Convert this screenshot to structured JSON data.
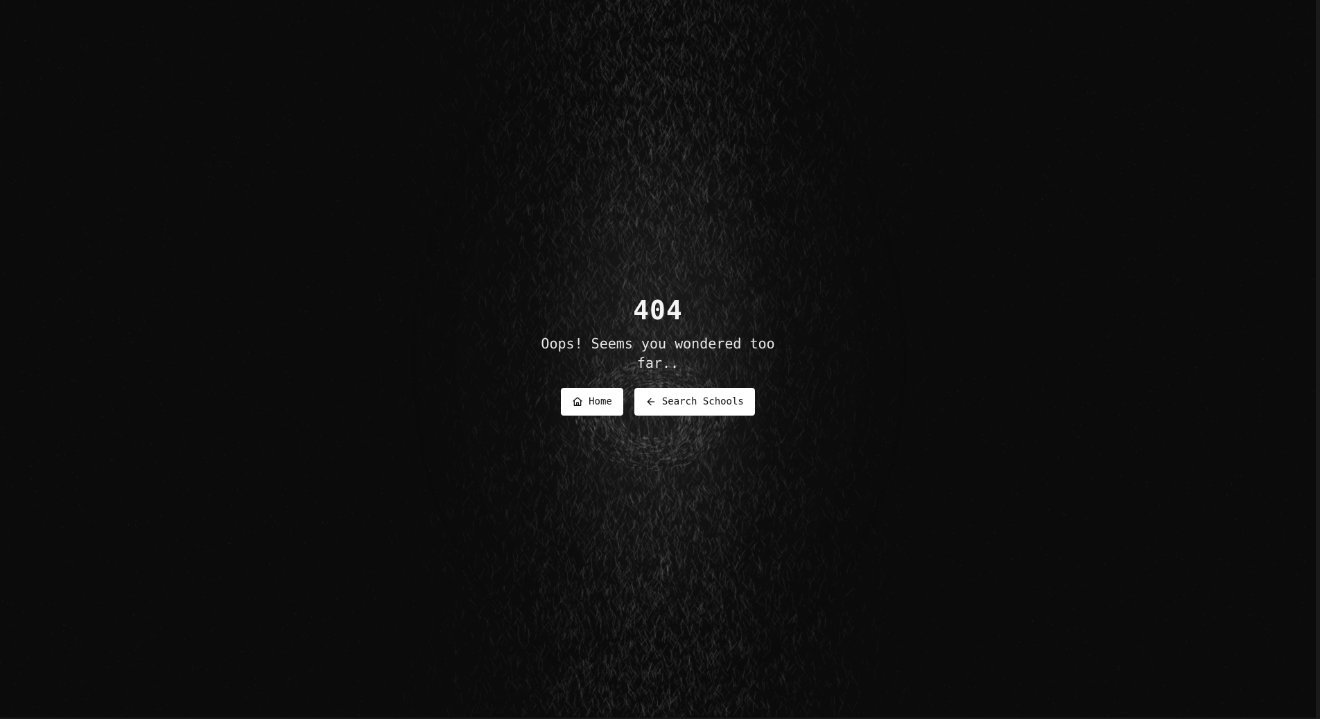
{
  "error": {
    "code": "404",
    "message": "Oops! Seems you wondered too far.."
  },
  "actions": {
    "home_label": "Home",
    "home_icon": "home-icon",
    "search_label": "Search Schools",
    "search_icon": "arrow-left-icon"
  },
  "colors": {
    "background": "#0b0b0b",
    "text": "#f5f5f5",
    "button_bg": "#ffffff",
    "button_text": "#111111"
  }
}
